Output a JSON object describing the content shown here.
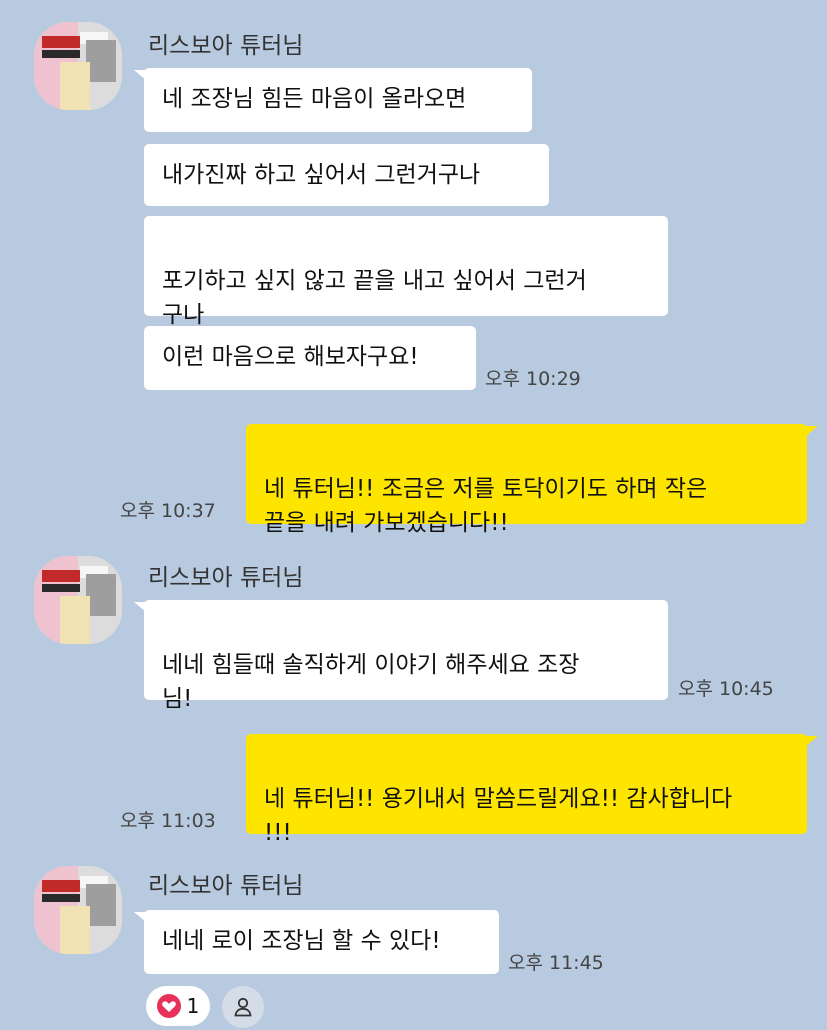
{
  "colors": {
    "background": "#b8cadf",
    "incoming_bubble": "#ffffff",
    "outgoing_bubble": "#fee500",
    "heart": "#e8315a"
  },
  "groups": [
    {
      "sender": "리스보아 튜터님",
      "messages": [
        "네 조장님 힘든 마음이 올라오면",
        "내가진짜 하고 싶어서 그런거구나",
        "포기하고 싶지 않고 끝을 내고 싶어서 그런거\n구나",
        "이런 마음으로 해보자구요!"
      ],
      "time": "오후 10:29"
    },
    {
      "sender": "리스보아 튜터님",
      "messages": [
        "네네 힘들때 솔직하게 이야기 해주세요 조장\n님!"
      ],
      "time": "오후 10:45"
    },
    {
      "sender": "리스보아 튜터님",
      "messages": [
        "네네 로이 조장님 할 수 있다!"
      ],
      "time": "오후 11:45"
    }
  ],
  "outgoing": [
    {
      "text": "네 튜터님!! 조금은 저를 토닥이기도 하며 작은\n끝을 내려 가보겠습니다!!",
      "time": "오후 10:37"
    },
    {
      "text": "네 튜터님!! 용기내서 말씀드릴게요!! 감사합니다\n!!!",
      "time": "오후 11:03"
    }
  ],
  "reaction": {
    "icon": "heart-icon",
    "count": "1"
  },
  "reaction_member_icon": "person-icon"
}
